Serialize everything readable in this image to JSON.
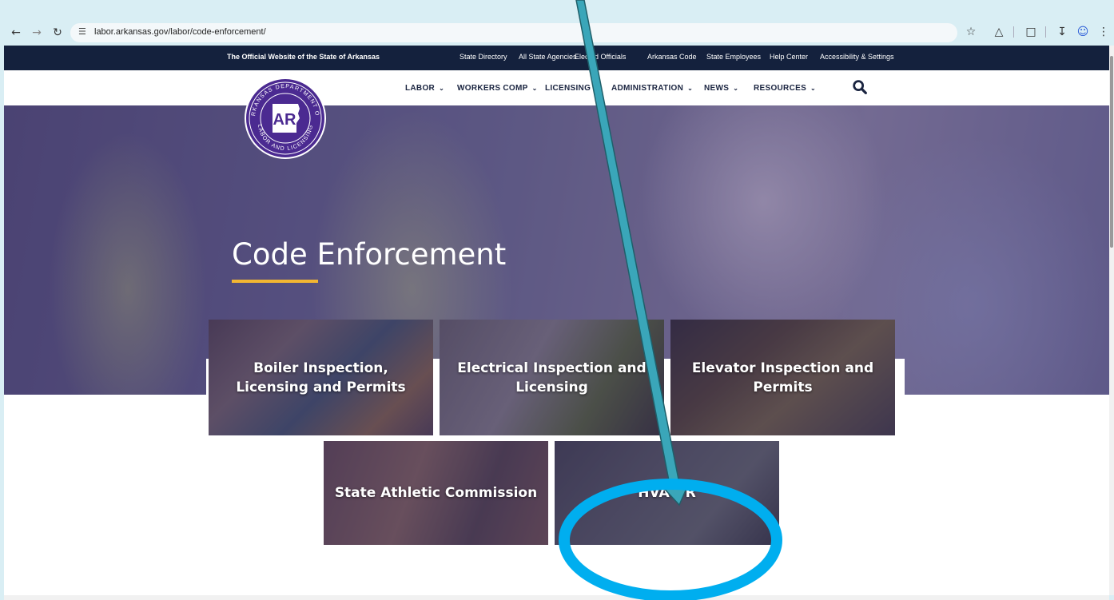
{
  "browser": {
    "url": "labor.arkansas.gov/labor/code-enforcement/"
  },
  "topbar": {
    "official": "The Official Website of the State of Arkansas",
    "links": [
      "State Directory",
      "All State Agencies",
      "Elected Officials",
      "Arkansas Code",
      "State Employees",
      "Help Center",
      "Accessibility & Settings"
    ]
  },
  "logo": {
    "text": "ARKANSAS DEPARTMENT OF LABOR AND LICENSING",
    "mark": "AR"
  },
  "nav": {
    "items": [
      "LABOR",
      "WORKERS COMP",
      "LICENSING",
      "ADMINISTRATION",
      "NEWS",
      "RESOURCES"
    ]
  },
  "hero": {
    "title": "Code Enforcement"
  },
  "tiles": [
    {
      "label": "Boiler Inspection, Licensing and Permits"
    },
    {
      "label": "Electrical Inspection and Licensing"
    },
    {
      "label": "Elevator Inspection and Permits"
    },
    {
      "label": "State Athletic Commission"
    },
    {
      "label": "HVAC-R"
    }
  ],
  "colors": {
    "topbar": "#14213d",
    "accent": "#f2b632",
    "logo_purple": "#4b2a91",
    "annotation_arrow": "#3aa6b9",
    "annotation_circle": "#00aeef"
  }
}
